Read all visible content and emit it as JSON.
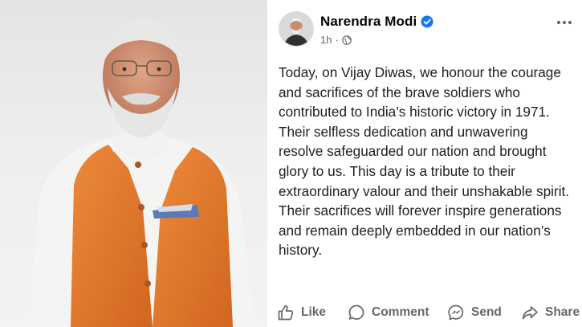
{
  "post": {
    "author": "Narendra Modi",
    "verified_icon": "verified-badge-icon",
    "timestamp": "1h",
    "separator": "·",
    "audience_icon": "globe-icon",
    "more_icon": "more-options-icon",
    "text": "Today, on Vijay Diwas, we honour the courage and sacrifices of the brave soldiers who contributed to India’s historic victory in 1971. Their selfless dedication and unwavering resolve safeguarded our nation and brought glory to us. This day is a tribute to their extraordinary valour and their unshakable spirit. Their sacrifices will forever inspire generations and remain deeply embedded in our nation’s history."
  },
  "actions": {
    "like": "Like",
    "comment": "Comment",
    "send": "Send",
    "share": "Share"
  },
  "colors": {
    "accent": "#1877f2",
    "text": "#1c1e21",
    "muted": "#65676b",
    "jacket": "#e0762c"
  }
}
